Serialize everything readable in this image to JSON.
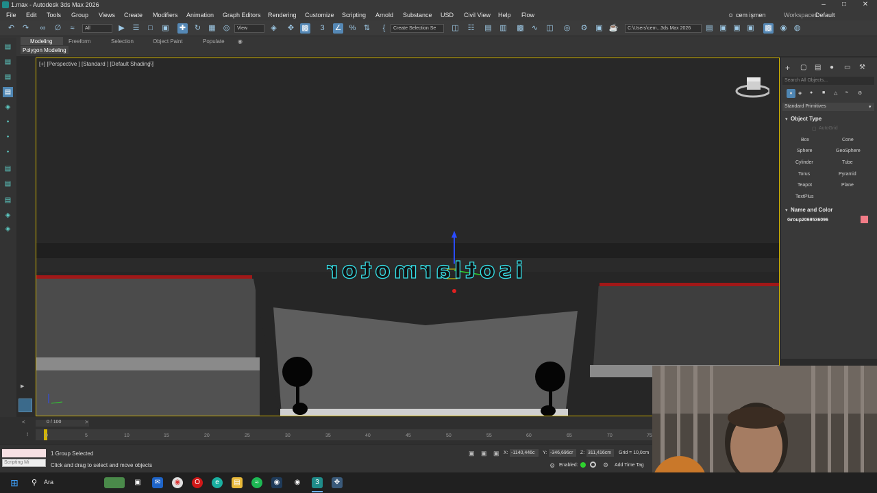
{
  "window": {
    "title": "1.max - Autodesk 3ds Max 2026"
  },
  "menu": [
    "File",
    "Edit",
    "Tools",
    "Group",
    "Views",
    "Create",
    "Modifiers",
    "Animation",
    "Graph Editors",
    "Rendering",
    "Customize",
    "Scripting",
    "Arnold",
    "Substance",
    "USD",
    "Civil View",
    "Help",
    "Flow"
  ],
  "user": {
    "name": "cem işmen",
    "workspaces_label": "Workspaces:",
    "workspace": "Default"
  },
  "toolbar": {
    "filter_value": "All",
    "view_value": "View",
    "selection_set_placeholder": "Create Selection Se",
    "project_path": "C:\\Users\\cem...3ds Max 2026"
  },
  "ribbon": {
    "tabs": [
      "Modeling",
      "Freeform",
      "Selection",
      "Object Paint",
      "Populate"
    ],
    "subtitle": "Polygon Modeling"
  },
  "viewport": {
    "label": "[+] [Perspective ] [Standard ] [Default Shading ]",
    "sign_text": "isotlarmotor"
  },
  "command_panel": {
    "search_placeholder": "Search All Objects...",
    "category": "Standard Primitives",
    "object_type_title": "Object Type",
    "autogrid_label": "AutoGrid",
    "primitives": [
      "Box",
      "Cone",
      "Sphere",
      "GeoSphere",
      "Cylinder",
      "Tube",
      "Torus",
      "Pyramid",
      "Teapot",
      "Plane",
      "TextPlus"
    ],
    "name_color_title": "Name and Color",
    "object_name": "Group2069536096",
    "object_color": "#f27c87"
  },
  "timeline": {
    "frame_counter": "0 / 100",
    "ticks": [
      "0",
      "5",
      "10",
      "15",
      "20",
      "25",
      "30",
      "35",
      "40",
      "45",
      "50",
      "55",
      "60",
      "65",
      "70",
      "75"
    ]
  },
  "status": {
    "script_placeholder": "Scripting Mi",
    "selection": "1 Group Selected",
    "prompt": "Click and drag to select and move objects",
    "x_label": "X:",
    "x_value": "-1140,446c",
    "y_label": "Y:",
    "y_value": "-346,696cr",
    "z_label": "Z:",
    "z_value": "311,416cm",
    "grid": "Grid = 10,0cm",
    "enabled_label": "Enabled:",
    "add_time_tag": "Add Time Tag"
  },
  "taskbar": {
    "search_text": "Ara"
  },
  "colors": {
    "accent": "#5588b5",
    "viewport_frame": "#d4b600",
    "neon": "#35e0e8"
  }
}
